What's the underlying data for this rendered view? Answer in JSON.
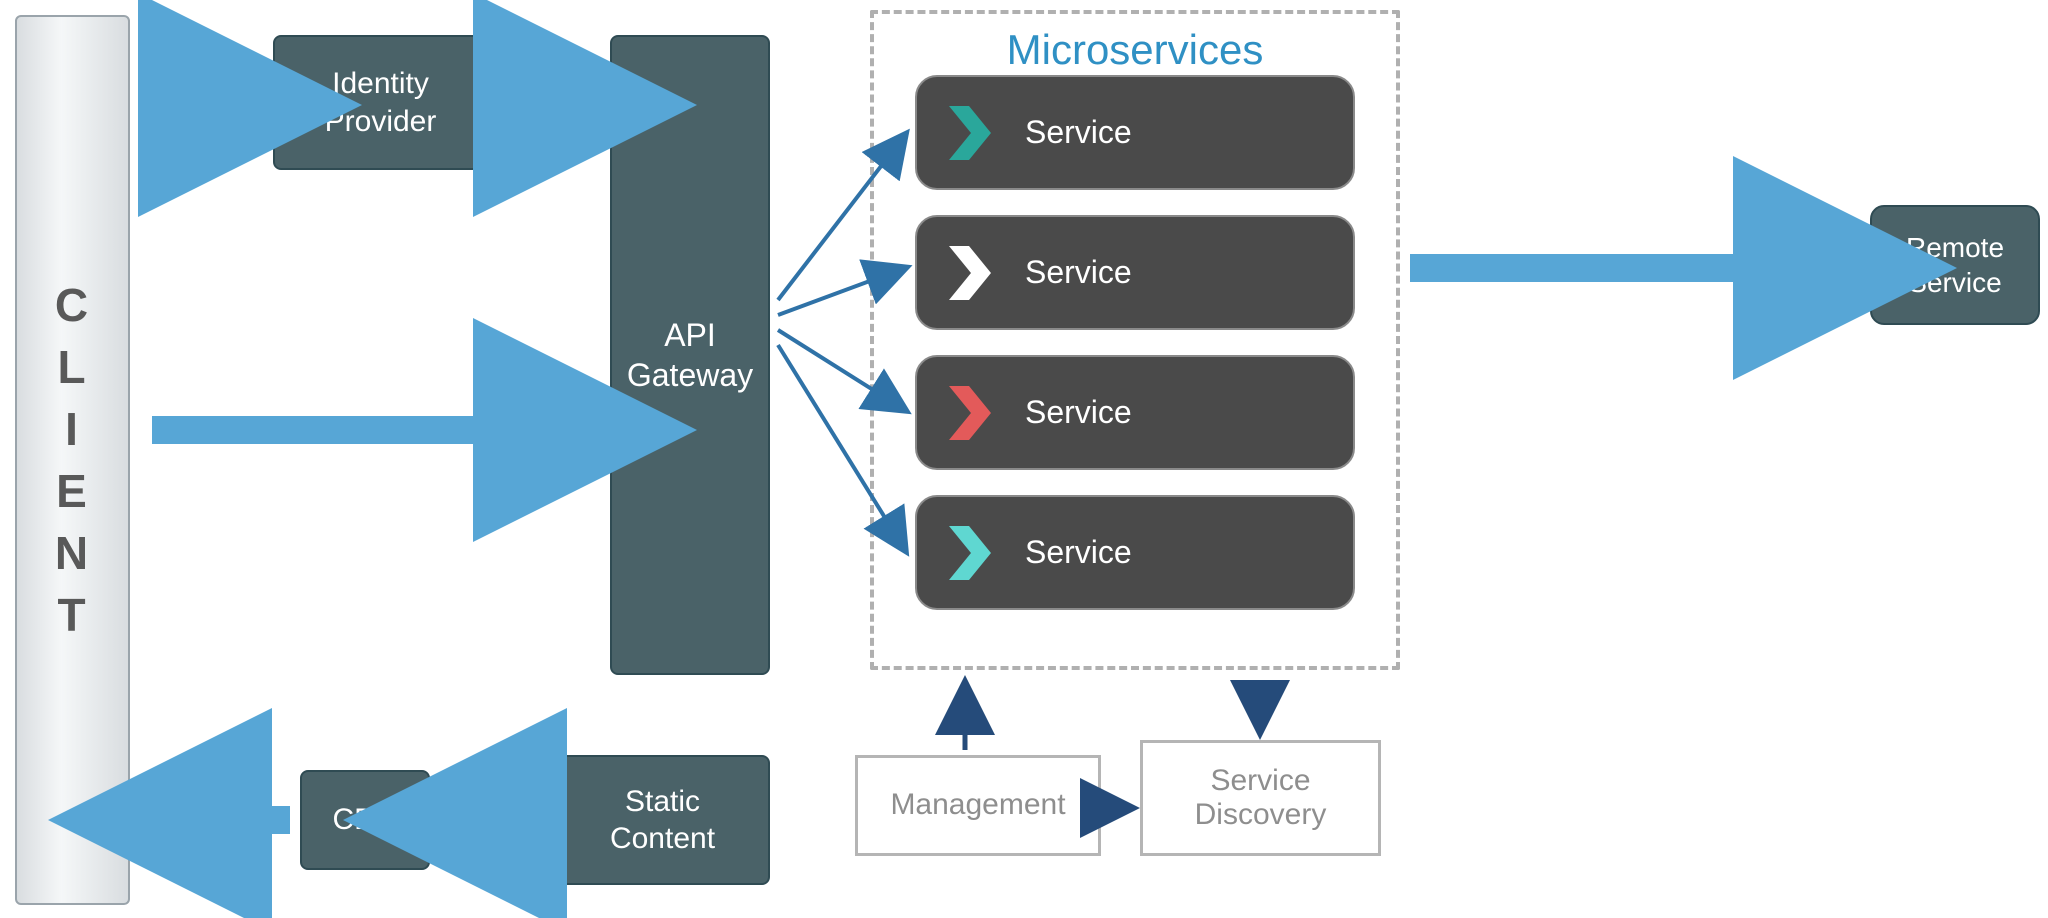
{
  "client": {
    "letters": [
      "C",
      "L",
      "I",
      "E",
      "N",
      "T"
    ]
  },
  "nodes": {
    "identity_provider": "Identity\nProvider",
    "api_gateway": "API\nGateway",
    "static_content": "Static\nContent",
    "cdn": "CDN",
    "remote_service": "Remote\nService",
    "management": "Management",
    "service_discovery": "Service\nDiscovery"
  },
  "microservices": {
    "title": "Microservices",
    "services": [
      {
        "label": "Service",
        "chevron_color": "#2aa79b"
      },
      {
        "label": "Service",
        "chevron_color": "#ffffff"
      },
      {
        "label": "Service",
        "chevron_color": "#e35a5a"
      },
      {
        "label": "Service",
        "chevron_color": "#5fd7d1"
      }
    ]
  },
  "colors": {
    "arrow_thick": "#57a6d6",
    "arrow_thin": "#2f72a7",
    "arrow_dark": "#254b7a"
  }
}
